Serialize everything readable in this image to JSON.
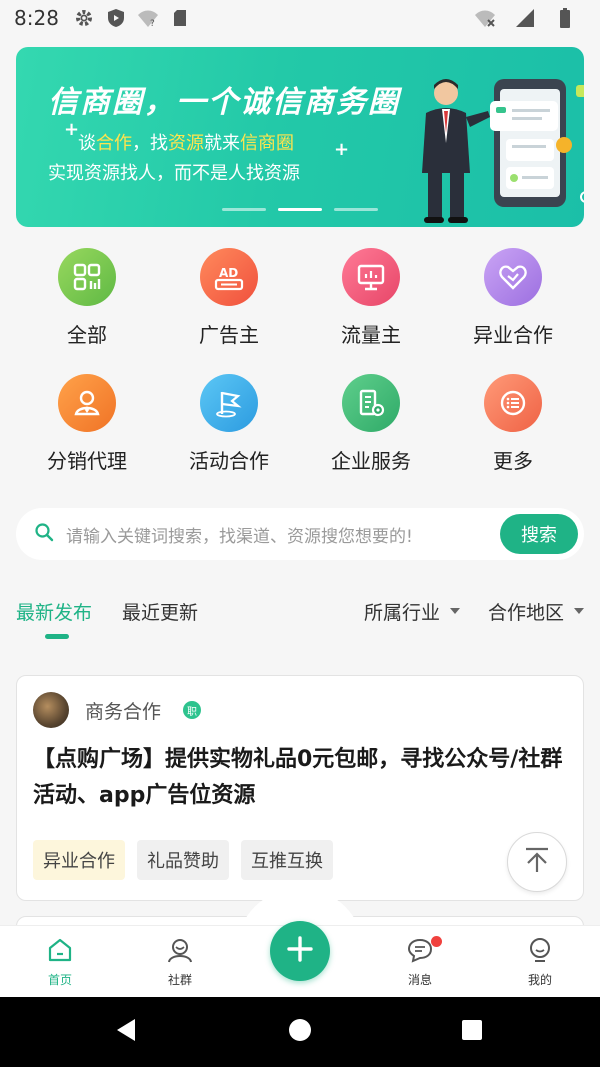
{
  "status_bar": {
    "time": "8:28"
  },
  "banner": {
    "title": "信商圈，一个诚信商务圈",
    "line1_parts": [
      "谈",
      "合作",
      "，找",
      "资源",
      "就来",
      "信商圈"
    ],
    "line2": "实现资源找人，而不是人找资源",
    "slides": 3,
    "active_slide": 2
  },
  "categories": [
    {
      "label": "全部",
      "icon": "grid-icon",
      "color": "#7cc94f"
    },
    {
      "label": "广告主",
      "icon": "ad-icon",
      "color": "#f46a4e"
    },
    {
      "label": "流量主",
      "icon": "monitor-icon",
      "color": "#ef5a7a"
    },
    {
      "label": "异业合作",
      "icon": "handshake-heart-icon",
      "color": "#b48ae8"
    },
    {
      "label": "分销代理",
      "icon": "agent-icon",
      "color": "#f6893a"
    },
    {
      "label": "活动合作",
      "icon": "flag-icon",
      "color": "#3fb3ec"
    },
    {
      "label": "企业服务",
      "icon": "company-icon",
      "color": "#3fba7a"
    },
    {
      "label": "更多",
      "icon": "list-icon",
      "color": "#f4785c"
    }
  ],
  "search": {
    "placeholder": "请输入关键词搜索，找渠道、资源搜您想要的!",
    "button": "搜索"
  },
  "tabs": [
    {
      "label": "最新发布",
      "active": true
    },
    {
      "label": "最近更新",
      "active": false
    }
  ],
  "filters": [
    "所属行业",
    "合作地区"
  ],
  "post": {
    "category": "商务合作",
    "badge": "职",
    "title": "【点购广场】提供实物礼品0元包邮，寻找公众号/社群活动、app广告位资源",
    "tags": [
      "异业合作",
      "礼品赞助",
      "互推互换"
    ]
  },
  "bottom_nav": [
    {
      "label": "首页",
      "icon": "home-icon",
      "active": true
    },
    {
      "label": "社群",
      "icon": "community-icon",
      "active": false
    },
    {
      "label": "消息",
      "icon": "message-icon",
      "active": false,
      "has_notification": true
    },
    {
      "label": "我的",
      "icon": "profile-icon",
      "active": false
    }
  ],
  "colors": {
    "accent": "#1fb386",
    "highlight": "#ffe44d",
    "notification": "#f0413e"
  }
}
